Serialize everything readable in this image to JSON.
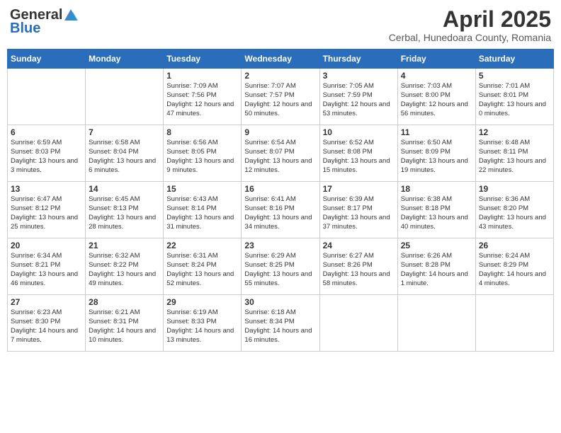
{
  "header": {
    "logo_general": "General",
    "logo_blue": "Blue",
    "title": "April 2025",
    "location": "Cerbal, Hunedoara County, Romania"
  },
  "weekdays": [
    "Sunday",
    "Monday",
    "Tuesday",
    "Wednesday",
    "Thursday",
    "Friday",
    "Saturday"
  ],
  "weeks": [
    [
      {
        "day": "",
        "info": ""
      },
      {
        "day": "",
        "info": ""
      },
      {
        "day": "1",
        "info": "Sunrise: 7:09 AM\nSunset: 7:56 PM\nDaylight: 12 hours and 47 minutes."
      },
      {
        "day": "2",
        "info": "Sunrise: 7:07 AM\nSunset: 7:57 PM\nDaylight: 12 hours and 50 minutes."
      },
      {
        "day": "3",
        "info": "Sunrise: 7:05 AM\nSunset: 7:59 PM\nDaylight: 12 hours and 53 minutes."
      },
      {
        "day": "4",
        "info": "Sunrise: 7:03 AM\nSunset: 8:00 PM\nDaylight: 12 hours and 56 minutes."
      },
      {
        "day": "5",
        "info": "Sunrise: 7:01 AM\nSunset: 8:01 PM\nDaylight: 13 hours and 0 minutes."
      }
    ],
    [
      {
        "day": "6",
        "info": "Sunrise: 6:59 AM\nSunset: 8:03 PM\nDaylight: 13 hours and 3 minutes."
      },
      {
        "day": "7",
        "info": "Sunrise: 6:58 AM\nSunset: 8:04 PM\nDaylight: 13 hours and 6 minutes."
      },
      {
        "day": "8",
        "info": "Sunrise: 6:56 AM\nSunset: 8:05 PM\nDaylight: 13 hours and 9 minutes."
      },
      {
        "day": "9",
        "info": "Sunrise: 6:54 AM\nSunset: 8:07 PM\nDaylight: 13 hours and 12 minutes."
      },
      {
        "day": "10",
        "info": "Sunrise: 6:52 AM\nSunset: 8:08 PM\nDaylight: 13 hours and 15 minutes."
      },
      {
        "day": "11",
        "info": "Sunrise: 6:50 AM\nSunset: 8:09 PM\nDaylight: 13 hours and 19 minutes."
      },
      {
        "day": "12",
        "info": "Sunrise: 6:48 AM\nSunset: 8:11 PM\nDaylight: 13 hours and 22 minutes."
      }
    ],
    [
      {
        "day": "13",
        "info": "Sunrise: 6:47 AM\nSunset: 8:12 PM\nDaylight: 13 hours and 25 minutes."
      },
      {
        "day": "14",
        "info": "Sunrise: 6:45 AM\nSunset: 8:13 PM\nDaylight: 13 hours and 28 minutes."
      },
      {
        "day": "15",
        "info": "Sunrise: 6:43 AM\nSunset: 8:14 PM\nDaylight: 13 hours and 31 minutes."
      },
      {
        "day": "16",
        "info": "Sunrise: 6:41 AM\nSunset: 8:16 PM\nDaylight: 13 hours and 34 minutes."
      },
      {
        "day": "17",
        "info": "Sunrise: 6:39 AM\nSunset: 8:17 PM\nDaylight: 13 hours and 37 minutes."
      },
      {
        "day": "18",
        "info": "Sunrise: 6:38 AM\nSunset: 8:18 PM\nDaylight: 13 hours and 40 minutes."
      },
      {
        "day": "19",
        "info": "Sunrise: 6:36 AM\nSunset: 8:20 PM\nDaylight: 13 hours and 43 minutes."
      }
    ],
    [
      {
        "day": "20",
        "info": "Sunrise: 6:34 AM\nSunset: 8:21 PM\nDaylight: 13 hours and 46 minutes."
      },
      {
        "day": "21",
        "info": "Sunrise: 6:32 AM\nSunset: 8:22 PM\nDaylight: 13 hours and 49 minutes."
      },
      {
        "day": "22",
        "info": "Sunrise: 6:31 AM\nSunset: 8:24 PM\nDaylight: 13 hours and 52 minutes."
      },
      {
        "day": "23",
        "info": "Sunrise: 6:29 AM\nSunset: 8:25 PM\nDaylight: 13 hours and 55 minutes."
      },
      {
        "day": "24",
        "info": "Sunrise: 6:27 AM\nSunset: 8:26 PM\nDaylight: 13 hours and 58 minutes."
      },
      {
        "day": "25",
        "info": "Sunrise: 6:26 AM\nSunset: 8:28 PM\nDaylight: 14 hours and 1 minute."
      },
      {
        "day": "26",
        "info": "Sunrise: 6:24 AM\nSunset: 8:29 PM\nDaylight: 14 hours and 4 minutes."
      }
    ],
    [
      {
        "day": "27",
        "info": "Sunrise: 6:23 AM\nSunset: 8:30 PM\nDaylight: 14 hours and 7 minutes."
      },
      {
        "day": "28",
        "info": "Sunrise: 6:21 AM\nSunset: 8:31 PM\nDaylight: 14 hours and 10 minutes."
      },
      {
        "day": "29",
        "info": "Sunrise: 6:19 AM\nSunset: 8:33 PM\nDaylight: 14 hours and 13 minutes."
      },
      {
        "day": "30",
        "info": "Sunrise: 6:18 AM\nSunset: 8:34 PM\nDaylight: 14 hours and 16 minutes."
      },
      {
        "day": "",
        "info": ""
      },
      {
        "day": "",
        "info": ""
      },
      {
        "day": "",
        "info": ""
      }
    ]
  ]
}
